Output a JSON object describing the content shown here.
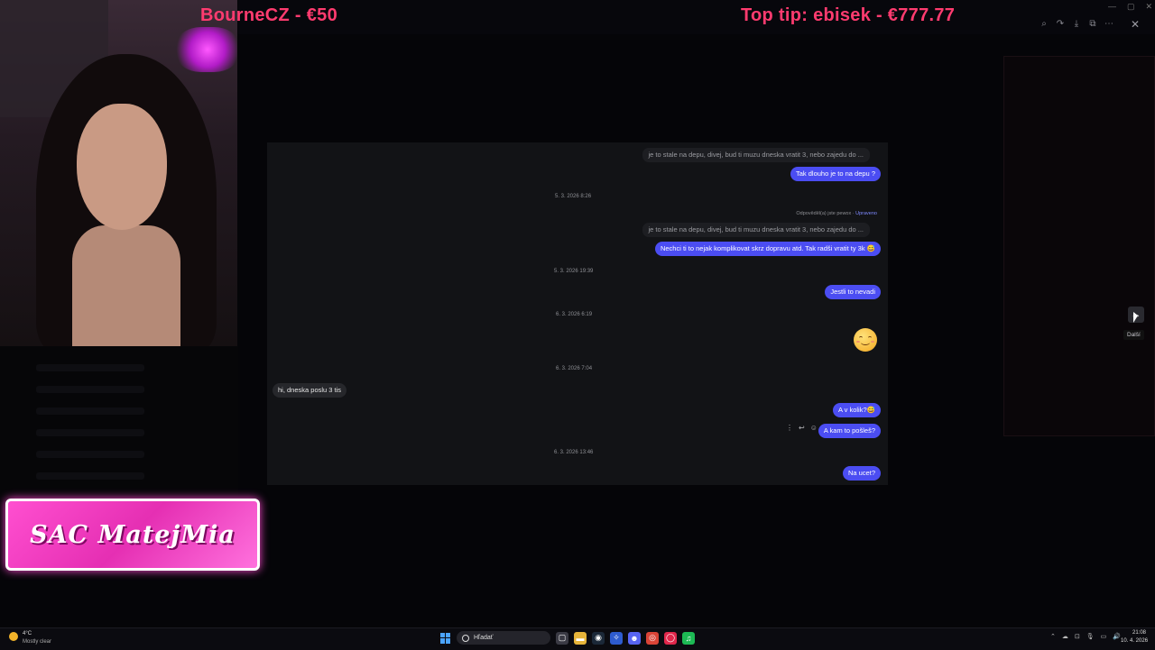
{
  "stream": {
    "donation_left": "BourneCZ - €50",
    "donation_right": "Top tip: ebisek - €777.77",
    "banner_text": "SAC MatejMia"
  },
  "viewer": {
    "tools": [
      {
        "name": "zoom-in-icon",
        "glyph": "⌕"
      },
      {
        "name": "redo-icon",
        "glyph": "↷"
      },
      {
        "name": "download-icon",
        "glyph": "⤓"
      },
      {
        "name": "open-external-icon",
        "glyph": "⧉"
      },
      {
        "name": "more-options-icon",
        "glyph": "⋯"
      }
    ],
    "close_glyph": "✕",
    "next_glyph": "→",
    "next_tooltip": "Další"
  },
  "chat": {
    "quote_1": "je to stale na depu, divej, bud ti muzu dneska vratit 3, nebo zajedu do ...",
    "out_1": "Tak dlouho je to na depu ?",
    "stamp_1": "5. 3. 2026 8:26",
    "replied_label": "Odpověděl(a) jste pewox · ",
    "replied_edited": "Upraveno",
    "quote_2": "je to stale na depu, divej, bud ti muzu dneska vratit 3, nebo zajedu do ...",
    "out_2": "Nechci ti to nejak komplikovat skrz dopravu atd. Tak radši vratit ty 3k 😅",
    "stamp_2": "5. 3. 2026 19:39",
    "out_3": "Jestli to nevadi",
    "stamp_3": "6. 3. 2026 6:19",
    "stamp_4": "6. 3. 2026 7:04",
    "in_1": "hi, dneska poslu 3 tis",
    "out_4": "A v kolik?😅",
    "out_5": "A kam to pošleš?",
    "stamp_5": "6. 3. 2026 13:46",
    "out_6": "Na ucet?",
    "actions": [
      "⋮",
      "↩",
      "☺"
    ]
  },
  "taskbar": {
    "weather_temp": "4°C",
    "weather_desc": "Mostly clear",
    "search_placeholder": "Hľadať",
    "time": "21:08",
    "date": "10. 4. 2026",
    "apps": [
      {
        "name": "task-view-icon",
        "glyph": "▢",
        "color": "#3a3a44"
      },
      {
        "name": "file-explorer-icon",
        "glyph": "▬",
        "color": "#e7b43a"
      },
      {
        "name": "steam-icon",
        "glyph": "◉",
        "color": "#1b2838"
      },
      {
        "name": "app-blue-icon",
        "glyph": "✧",
        "color": "#2e5ccf"
      },
      {
        "name": "discord-icon",
        "glyph": "☻",
        "color": "#5865f2"
      },
      {
        "name": "chrome-icon",
        "glyph": "◎",
        "color": "#db4437"
      },
      {
        "name": "opera-gx-icon",
        "glyph": "◯",
        "color": "#e0274b"
      },
      {
        "name": "spotify-icon",
        "glyph": "♫",
        "color": "#1db954"
      }
    ],
    "tray": [
      "⌃",
      "☁",
      "⊡",
      "🎙",
      "▭",
      "🔊"
    ]
  }
}
